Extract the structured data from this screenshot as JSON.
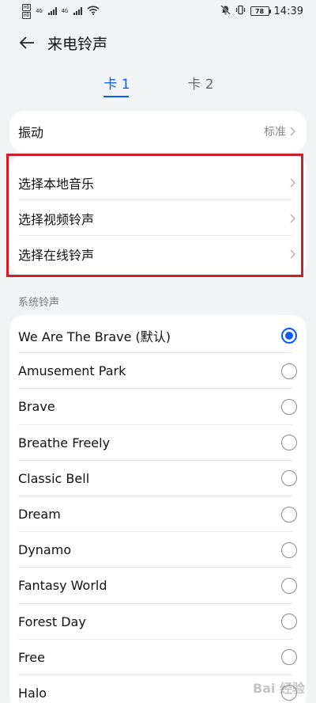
{
  "status_bar": {
    "sim1": "HD",
    "sim2": "HD",
    "net1": "4G",
    "net2": "4G",
    "battery": "78",
    "time": "14:39"
  },
  "header": {
    "title": "来电铃声"
  },
  "tabs": [
    {
      "label": "卡 1",
      "active": true
    },
    {
      "label": "卡 2",
      "active": false
    }
  ],
  "vibration": {
    "label": "振动",
    "value": "标准"
  },
  "options": [
    {
      "label": "选择本地音乐"
    },
    {
      "label": "选择视频铃声"
    },
    {
      "label": "选择在线铃声"
    }
  ],
  "system_ringtones": {
    "header": "系统铃声",
    "items": [
      {
        "label": "We Are The Brave (默认)",
        "selected": true
      },
      {
        "label": "Amusement Park",
        "selected": false
      },
      {
        "label": "Brave",
        "selected": false
      },
      {
        "label": "Breathe Freely",
        "selected": false
      },
      {
        "label": "Classic Bell",
        "selected": false
      },
      {
        "label": "Dream",
        "selected": false
      },
      {
        "label": "Dynamo",
        "selected": false
      },
      {
        "label": "Fantasy World",
        "selected": false
      },
      {
        "label": "Forest Day",
        "selected": false
      },
      {
        "label": "Free",
        "selected": false
      },
      {
        "label": "Halo",
        "selected": false
      }
    ]
  },
  "watermark": "Bai 经验",
  "colors": {
    "accent": "#0a59f7",
    "highlight": "#c8202a",
    "background": "#f1f3f5"
  }
}
